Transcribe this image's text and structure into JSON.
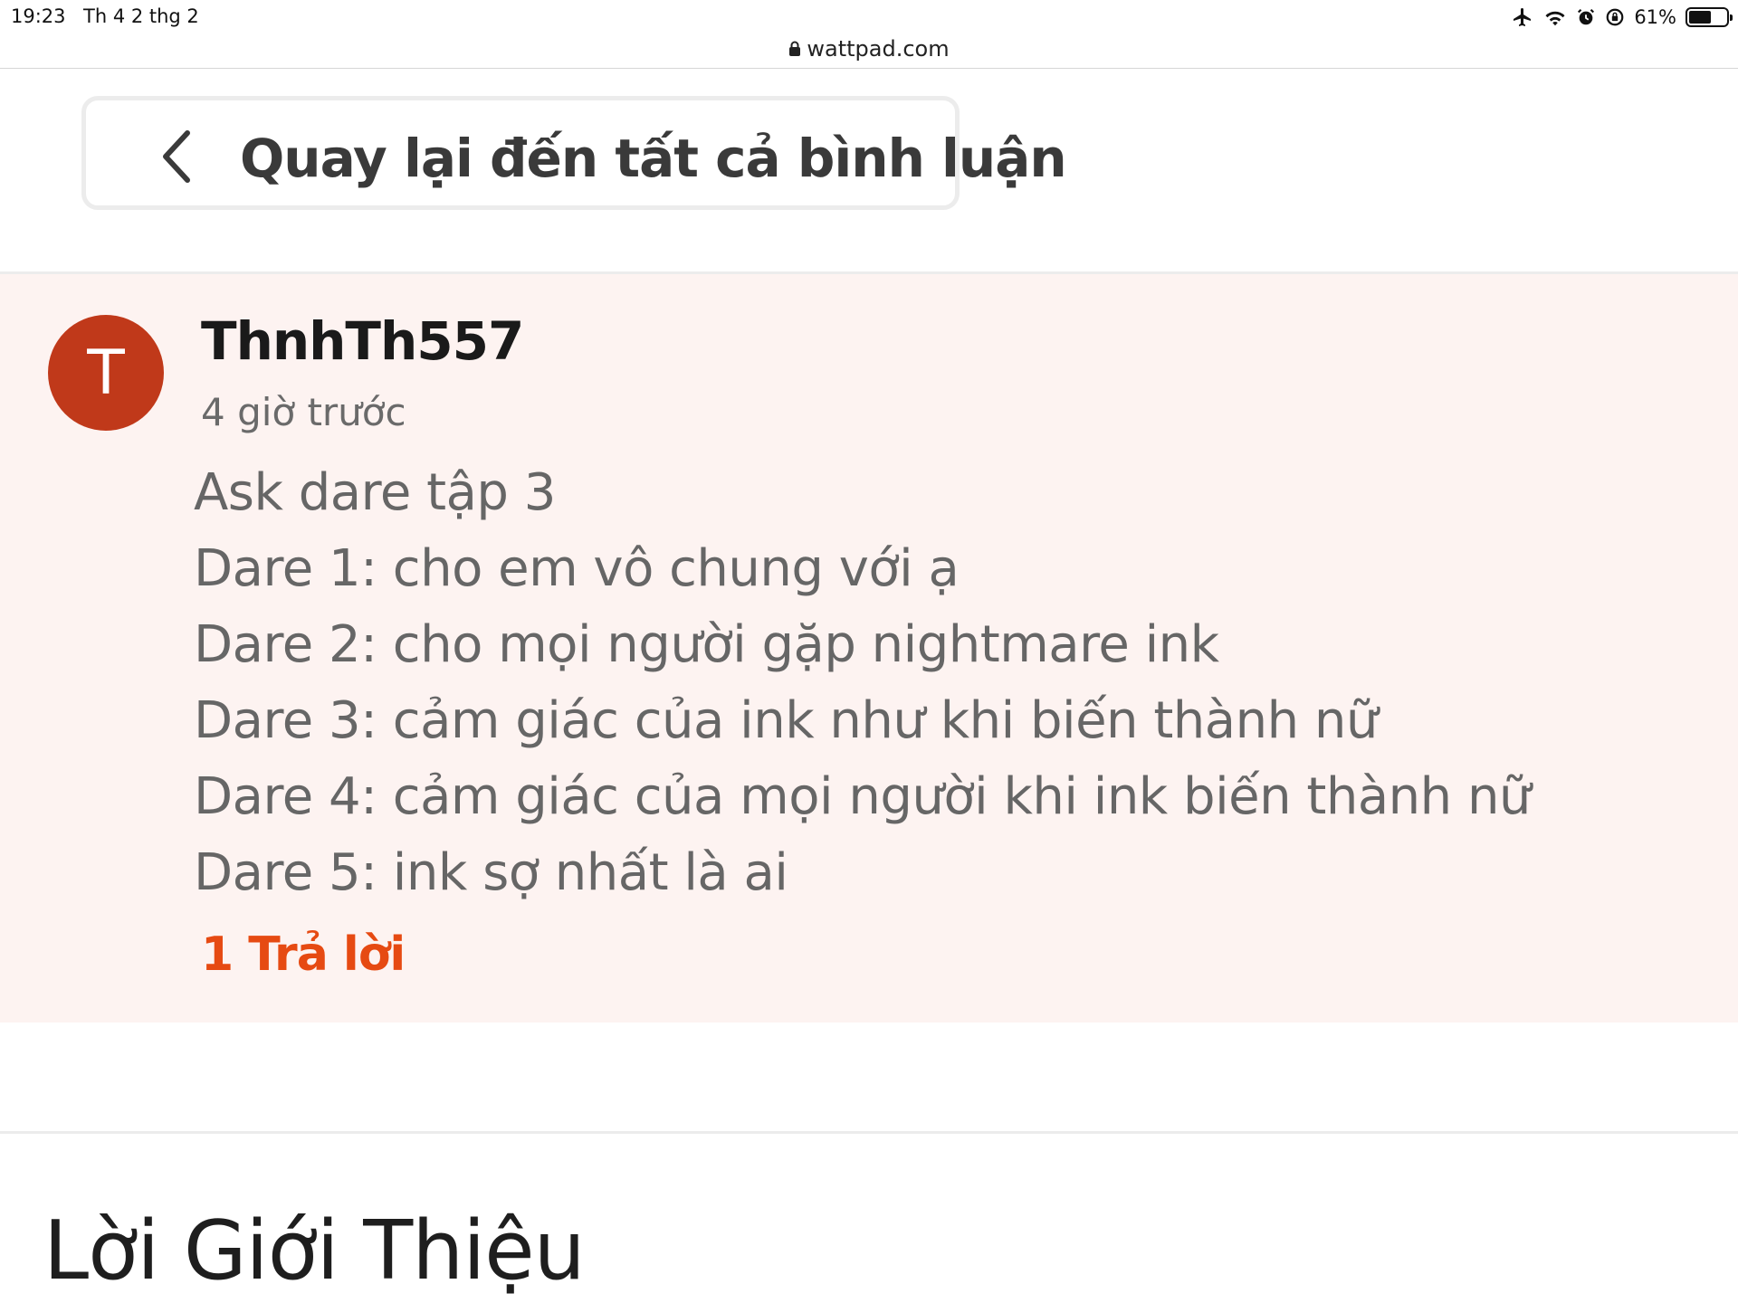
{
  "status_bar": {
    "time": "19:23",
    "date": "Th 4 2 thg 2",
    "battery_percent": "61%",
    "battery_level": 0.61,
    "icons": [
      "airplane-icon",
      "wifi-icon",
      "alarm-icon",
      "orientation-lock-icon",
      "battery-icon"
    ]
  },
  "browser": {
    "url": "wattpad.com"
  },
  "back_button": {
    "label": "Quay lại đến tất cả bình luận",
    "icon": "chevron-left-icon"
  },
  "comment": {
    "avatar_letter": "T",
    "avatar_color": "#c0391a",
    "username": "ThnhTh557",
    "timestamp": "4 giờ trước",
    "lines": [
      "Ask dare tập 3",
      "Dare 1: cho em vô chung với ạ",
      "Dare 2: cho mọi người gặp nightmare ink",
      "Dare 3: cảm giác của ink như khi biến thành nữ",
      "Dare 4: cảm giác của mọi người khi ink biến thành nữ",
      "Dare 5: ink sợ nhất là ai"
    ],
    "reply_link": "1 Trả lời",
    "reply_color": "#e64a12",
    "background_color": "#fdf3f1"
  },
  "section": {
    "title": "Lời Giới Thiệu"
  }
}
